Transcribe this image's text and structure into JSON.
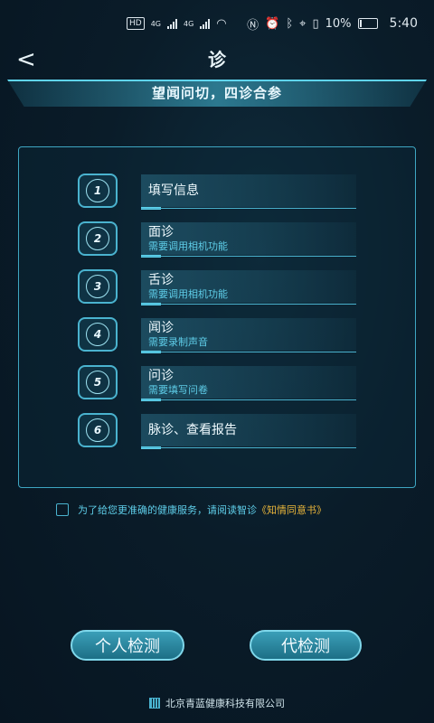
{
  "status_bar": {
    "hd_label": "HD",
    "network_1": "4G",
    "network_2": "4G",
    "battery_percent": "10%",
    "time": "5:40"
  },
  "nav": {
    "back_icon": "chevron-left-icon",
    "title": "诊"
  },
  "banner": {
    "text": "望闻问切，四诊合参"
  },
  "steps": [
    {
      "number": "1",
      "title": "填写信息",
      "subtitle": ""
    },
    {
      "number": "2",
      "title": "面诊",
      "subtitle": "需要调用相机功能"
    },
    {
      "number": "3",
      "title": "舌诊",
      "subtitle": "需要调用相机功能"
    },
    {
      "number": "4",
      "title": "闻诊",
      "subtitle": "需要录制声音"
    },
    {
      "number": "5",
      "title": "问诊",
      "subtitle": "需要填写问卷"
    },
    {
      "number": "6",
      "title": "脉诊、查看报告",
      "subtitle": ""
    }
  ],
  "consent": {
    "text": "为了给您更准确的健康服务，请阅读智诊",
    "link": "《知情同意书》",
    "checked": false
  },
  "buttons": {
    "self_check": "个人检测",
    "proxy_check": "代检测"
  },
  "footer": {
    "company": "北京青蓝健康科技有限公司"
  },
  "colors": {
    "accent": "#4ab3cf",
    "link": "#e7b43a",
    "background": "#0a1c29"
  }
}
